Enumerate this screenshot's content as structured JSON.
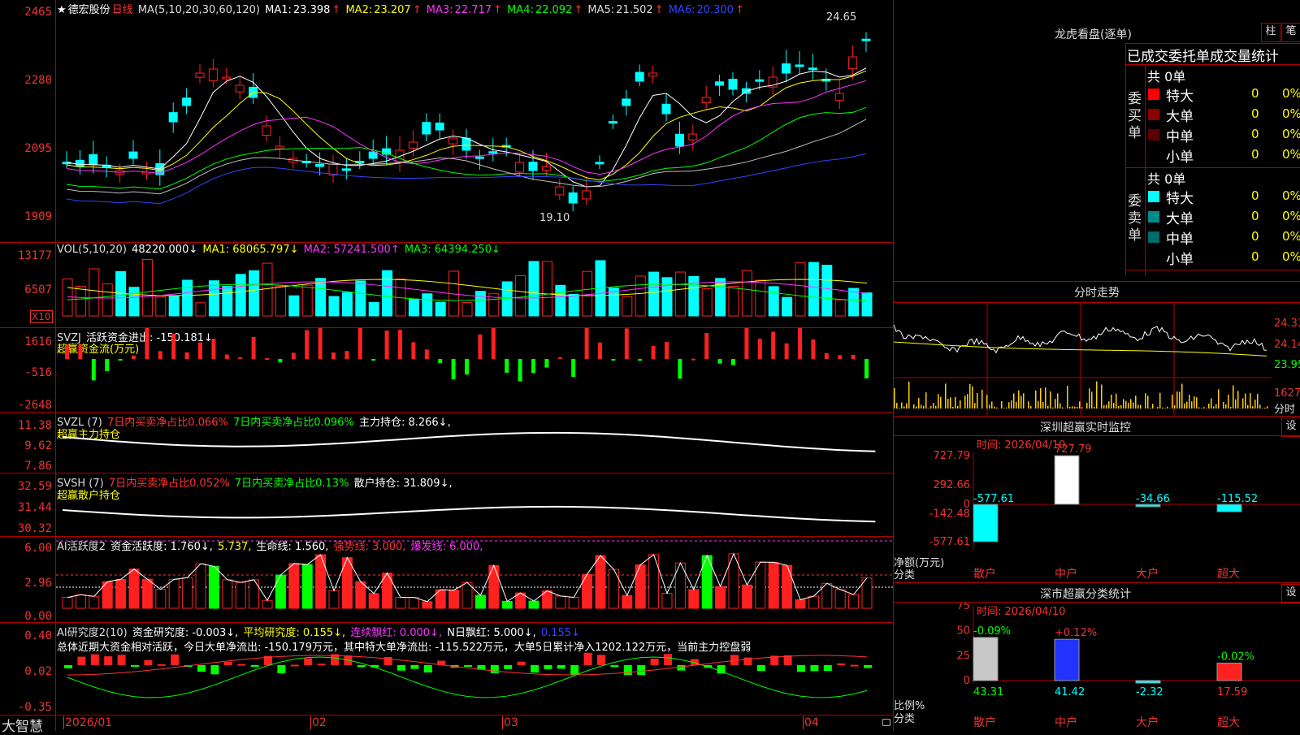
{
  "header": {
    "star": "★",
    "stock_name": "德宏股份",
    "period": "日线",
    "ma_params": "MA(5,10,20,30,60,120)",
    "ma": [
      {
        "label": "MA1:",
        "value": "23.398",
        "arrow": "↑",
        "color": "#ffffff"
      },
      {
        "label": "MA2:",
        "value": "23.207",
        "arrow": "↑",
        "color": "#ffff00"
      },
      {
        "label": "MA3:",
        "value": "22.717",
        "arrow": "↑",
        "color": "#ff33ff"
      },
      {
        "label": "MA4:",
        "value": "22.092",
        "arrow": "↑",
        "color": "#00ff00"
      },
      {
        "label": "MA5:",
        "value": "21.502",
        "arrow": "↑",
        "color": "#c0c0c0"
      },
      {
        "label": "MA6:",
        "value": "20.300",
        "arrow": "↑",
        "color": "#3344ff"
      }
    ]
  },
  "price_axis": [
    "2465",
    "2280",
    "2095",
    "1909"
  ],
  "price_marks": {
    "high": "24.65",
    "low": "19.10"
  },
  "volume": {
    "label": "VOL(5,10,20)",
    "value": "48220.000↓",
    "ma1": "MA1: 68065.797↓",
    "ma2": "MA2: 57241.500↑",
    "ma3": "MA3: 64394.250↓",
    "axis": [
      "13177",
      "6507"
    ],
    "unit": "X10"
  },
  "svzj": {
    "name": "SVZJ",
    "text": "活跃资金进出: -150.181↓",
    "sub": "超赢资金流(万元)",
    "axis": [
      "1616",
      "-516",
      "-2648"
    ]
  },
  "svzl": {
    "name": "SVZL (7)",
    "t1": "7日内买卖净占比0.066%",
    "t2": "7日内买卖净占比0.096%",
    "t3": "主力持仓: 8.266↓,",
    "sub": "超赢主力持仓",
    "axis": [
      "11.38",
      "9.62",
      "7.86"
    ]
  },
  "svsh": {
    "name": "SVSH (7)",
    "t1": "7日内买卖净占比0.052%",
    "t2": "7日内买卖净占比0.13%",
    "t3": "散户持仓: 31.809↓,",
    "sub": "超赢散户持仓",
    "axis": [
      "32.59",
      "31.44",
      "30.32"
    ]
  },
  "ai_active": {
    "name": "AI活跃度2",
    "t1": "资金活跃度: 1.760↓,",
    "t2": "5.737,",
    "t3": "生命线: 1.560,",
    "t4": "强势线: 3.000,",
    "t5": "爆发线: 6.000,",
    "axis": [
      "6.00",
      "2.96",
      "0.00"
    ]
  },
  "ai_research": {
    "name": "AI研究度2(10)",
    "t1": "资金研究度: -0.003↓,",
    "t2": "平均研究度: 0.155↓,",
    "t3": "连续飘红: 0.000↓,",
    "t4": "N日飘红: 5.000↓,",
    "t5": "0.155↓",
    "summary": "总体近期大资金相对活跃，今日大单净流出: -150.179万元，其中特大单净流出: -115.522万元，大单5日累计净入1202.122万元，当前主力控盘弱",
    "axis": [
      "0.40",
      "0.02",
      "-0.35"
    ]
  },
  "date_axis": {
    "brand": "大智慧",
    "dates": [
      "2026/01",
      "02",
      "03",
      "04"
    ]
  },
  "right_top": {
    "title": "龙虎看盘(逐单)",
    "btn1": "柱",
    "btn2": "笔",
    "header": "已成交委托单成交量统计",
    "buy_group": "委买单",
    "sell_group": "委卖单",
    "buy_total": "共 0单",
    "sell_total": "共 0单",
    "buy_rows": [
      {
        "label": "特大",
        "count": "0",
        "pct": "0%",
        "color": "#ff0000"
      },
      {
        "label": "大单",
        "count": "0",
        "pct": "0%",
        "color": "#8b0000"
      },
      {
        "label": "中单",
        "count": "0",
        "pct": "0%",
        "color": "#5a0000"
      },
      {
        "label": "小单",
        "count": "0",
        "pct": "0%",
        "color": "#000000"
      }
    ],
    "sell_rows": [
      {
        "label": "特大",
        "count": "0",
        "pct": "0%",
        "color": "#00ffff"
      },
      {
        "label": "大单",
        "count": "0",
        "pct": "0%",
        "color": "#008b8b"
      },
      {
        "label": "中单",
        "count": "0",
        "pct": "0%",
        "color": "#006b6b"
      },
      {
        "label": "小单",
        "count": "0",
        "pct": "0%",
        "color": "#000000"
      }
    ]
  },
  "intraday": {
    "title": "分时走势",
    "axis": [
      "24.33",
      "24.14",
      "23.95"
    ],
    "vol": "1627",
    "vol_label": "分时"
  },
  "sz_monitor": {
    "title": "深圳超赢实时监控",
    "btn": "设",
    "time": "时间: 2026/04/10",
    "axis": [
      "727.79",
      "292.66",
      "0",
      "-142.48",
      "-577.61"
    ],
    "bars": [
      {
        "cat": "散户",
        "value": "-577.61"
      },
      {
        "cat": "中户",
        "value": "727.79"
      },
      {
        "cat": "大户",
        "value": "-34.66"
      },
      {
        "cat": "超大",
        "value": "-115.52"
      }
    ],
    "ylabel": "净额(万元)",
    "xlabel": "分类"
  },
  "sz_class": {
    "title": "深市超赢分类统计",
    "btn": "设",
    "time": "时间: 2026/04/10",
    "axis": [
      "75",
      "50",
      "25",
      "0"
    ],
    "bars": [
      {
        "cat": "散户",
        "value": "43.31",
        "delta": "-0.09%"
      },
      {
        "cat": "中户",
        "value": "41.42",
        "delta": "+0.12%"
      },
      {
        "cat": "大户",
        "value": "-2.32",
        "delta": ""
      },
      {
        "cat": "超大",
        "value": "17.59",
        "delta": "-0.02%"
      }
    ],
    "ylabel": "比例%",
    "xlabel": "分类"
  }
}
